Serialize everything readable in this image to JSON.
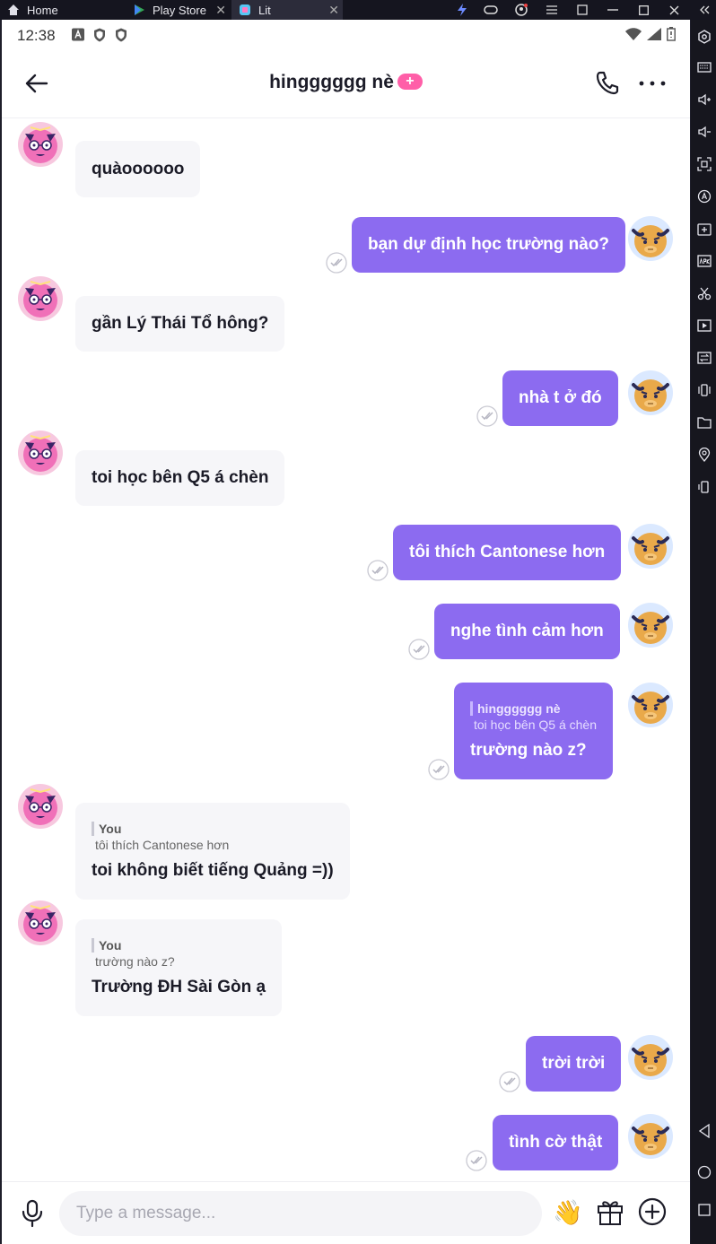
{
  "emulator": {
    "tabs": [
      {
        "label": "Home"
      },
      {
        "label": "Play Store"
      },
      {
        "label": "Lit"
      }
    ],
    "close_glyph": "✕"
  },
  "status_bar": {
    "time": "12:38"
  },
  "header": {
    "title": "hingggggg nè",
    "badge": "+"
  },
  "messages": [
    {
      "from": "them",
      "text": "quàoooooo"
    },
    {
      "from": "me",
      "text": "bạn dự định học trường nào?"
    },
    {
      "from": "them",
      "text": "gần Lý Thái Tổ hông?"
    },
    {
      "from": "me",
      "text": "nhà t ở đó"
    },
    {
      "from": "them",
      "text": "toi học bên Q5 á chèn"
    },
    {
      "from": "me",
      "text": "tôi thích Cantonese hơn"
    },
    {
      "from": "me",
      "text": "nghe tình cảm hơn"
    },
    {
      "from": "me",
      "text": "trường nào z?",
      "reply_name": "hingggggg nè",
      "reply_text": "toi học bên Q5 á chèn"
    },
    {
      "from": "them",
      "text": "toi không biết tiếng Quảng =))",
      "reply_name": "You",
      "reply_text": "tôi thích Cantonese hơn"
    },
    {
      "from": "them",
      "text": "Trường ĐH Sài Gòn ạ",
      "reply_name": "You",
      "reply_text": "trường nào z?"
    },
    {
      "from": "me",
      "text": "trời trời"
    },
    {
      "from": "me",
      "text": "tình cờ thật"
    }
  ],
  "composer": {
    "placeholder": "Type a message...",
    "wave_emoji": "👋"
  },
  "colors": {
    "accent": "#8c6bf0",
    "badge": "#ff5fa8",
    "incoming_bubble": "#f6f6f9"
  }
}
